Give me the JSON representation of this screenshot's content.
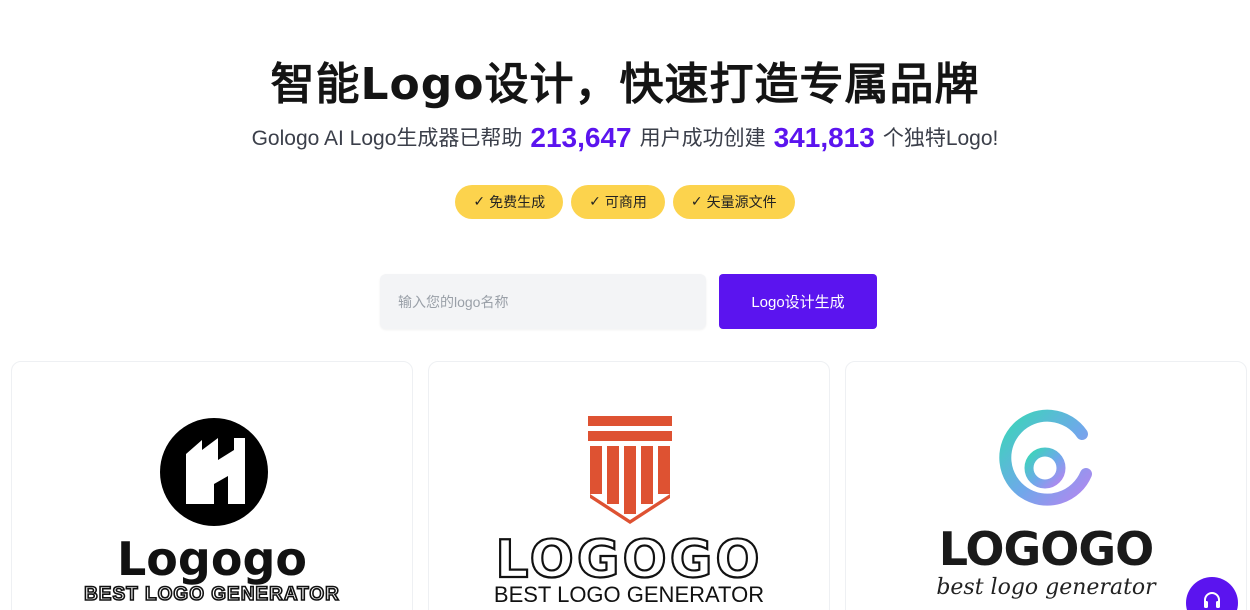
{
  "hero": {
    "title": "智能Logo设计，快速打造专属品牌",
    "sub_part1": "Gologo AI Logo生成器已帮助",
    "users_count": "213,647",
    "sub_part2": "用户成功创建",
    "logos_count": "341,813",
    "sub_part3": "个独特Logo!"
  },
  "tags": [
    {
      "label": "免费生成"
    },
    {
      "label": "可商用"
    },
    {
      "label": "矢量源文件"
    }
  ],
  "search": {
    "placeholder": "输入您的logo名称",
    "value": "",
    "button_label": "Logo设计生成"
  },
  "cards": [
    {
      "wordmark": "Logogo",
      "tagline": "BEST LOGO GENERATOR"
    },
    {
      "wordmark": "LOGOGO",
      "tagline": "BEST LOGO GENERATOR"
    },
    {
      "wordmark": "LOGOGO",
      "tagline": "best logo generator"
    }
  ],
  "colors": {
    "accent": "#5b14ef",
    "tag_bg": "#fcd34d",
    "card2_brand": "#de5232"
  },
  "icons": {
    "tag_check": "check-icon",
    "support": "headset-icon"
  }
}
